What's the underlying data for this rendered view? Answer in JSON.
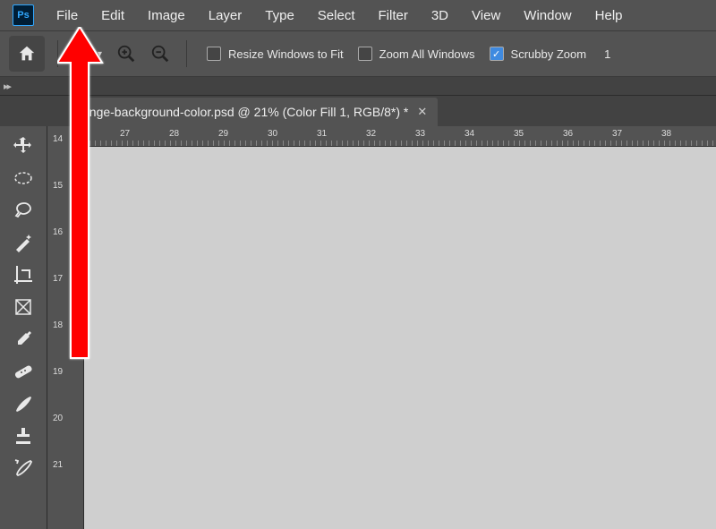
{
  "app": {
    "logo_text": "Ps"
  },
  "menu": [
    "File",
    "Edit",
    "Image",
    "Layer",
    "Type",
    "Select",
    "Filter",
    "3D",
    "View",
    "Window",
    "Help"
  ],
  "options": {
    "resize_label": "Resize Windows to Fit",
    "zoom_all_label": "Zoom All Windows",
    "scrubby_label": "Scrubby Zoom",
    "zoom_value": "1"
  },
  "document": {
    "tab_title": "ange-background-color.psd @ 21% (Color Fill 1, RGB/8*) *"
  },
  "ruler_h": [
    "27",
    "28",
    "29",
    "30",
    "31",
    "32",
    "33",
    "34",
    "35",
    "36",
    "37",
    "38"
  ],
  "ruler_v": [
    "14",
    "15",
    "16",
    "17",
    "18",
    "19",
    "20",
    "21"
  ],
  "panel_toggle": "▸▸"
}
